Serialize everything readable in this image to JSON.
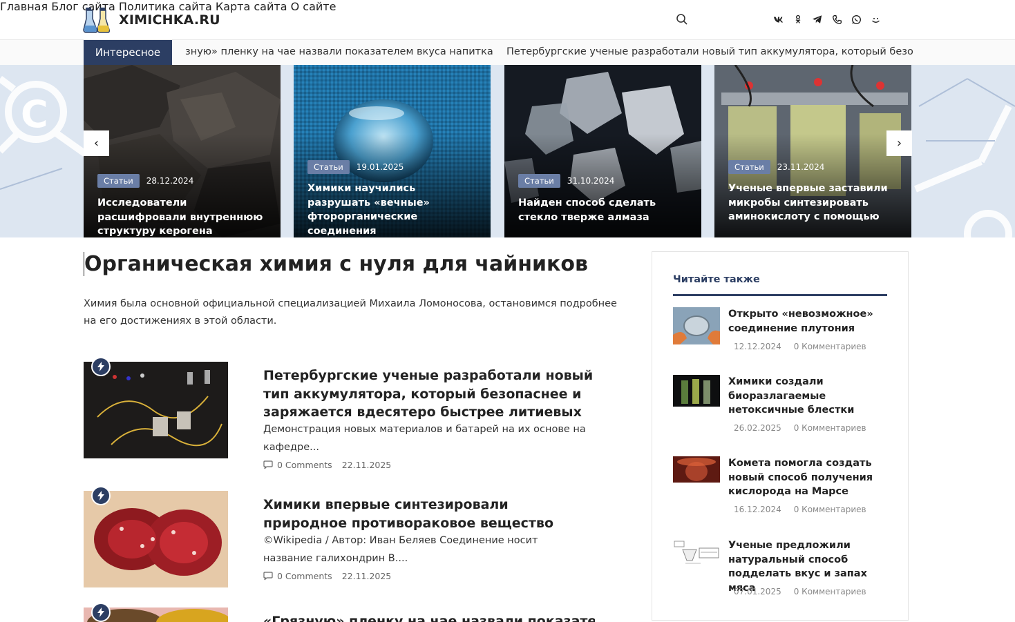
{
  "site": {
    "name": "XIMICHKA.RU"
  },
  "nav": [
    "Главная",
    "Блог сайта",
    "Политика сайта",
    "Карта сайта",
    "О сайте"
  ],
  "socials": [
    "vk-icon",
    "odnoklassniki-icon",
    "telegram-icon",
    "phone-icon",
    "whatsapp-icon",
    "yandex-zen-icon"
  ],
  "ticker": {
    "label": "Интересное",
    "items": [
      "зную» пленку на чае назвали показателем вкуса напитка",
      "Петербургские ученые разработали новый тип аккумулятора, который безопас"
    ]
  },
  "slider": {
    "prev": "‹",
    "next": "›",
    "slides": [
      {
        "category": "Статьи",
        "date": "28.12.2024",
        "title": "Исследователи расшифровали внутреннюю структуру керогена"
      },
      {
        "category": "Статьи",
        "date": "19.01.2025",
        "title": "Химики научились разрушать «вечные» фторорганические соединения"
      },
      {
        "category": "Статьи",
        "date": "31.10.2024",
        "title": "Найден способ сделать стекло тверже алмаза"
      },
      {
        "category": "Статьи",
        "date": "23.11.2024",
        "title": "Ученые впервые заставили микробы синтезировать аминокислоту с помощью"
      }
    ]
  },
  "main": {
    "title": "Органическая химия с нуля для чайников",
    "intro": "Химия была основной официальной специализацией Михаила Ломоносова, остановимся подробнее на его достижениях в этой области.",
    "posts": [
      {
        "title": "Петербургские ученые разработали новый тип аккумулятора, который безопаснее и заряжается вдесятеро быстрее литиевых",
        "excerpt": "Демонстрация новых материалов и батарей на их основе на кафедре...",
        "comments": "0 Comments",
        "date": "22.11.2025"
      },
      {
        "title": "Химики впервые синтезировали природное противораковое вещество",
        "excerpt": "©Wikipedia / Автор: Иван Беляев Соединение носит название галихондрин B....",
        "comments": "0 Comments",
        "date": "22.11.2025"
      },
      {
        "title": "«Грязную» пленку на чае назвали показателем",
        "excerpt": "",
        "comments": "",
        "date": ""
      }
    ]
  },
  "sidebar": {
    "title": "Читайте также",
    "items": [
      {
        "title": "Открыто «невозможное» соединение плутония",
        "date": "12.12.2024",
        "comments": "0 Комментариев"
      },
      {
        "title": "Химики создали биоразлагаемые нетоксичные блестки",
        "date": "26.02.2025",
        "comments": "0 Комментариев"
      },
      {
        "title": "Комета помогла создать новый способ получения кислорода на Марсе",
        "date": "16.12.2024",
        "comments": "0 Комментариев"
      },
      {
        "title": "Ученые предложили натуральный способ подделать вкус и запах мяса",
        "date": "07.01.2025",
        "comments": "0 Комментариев"
      }
    ]
  },
  "colors": {
    "accent": "#2c3e63",
    "category_badge": "#6a7ea6"
  }
}
